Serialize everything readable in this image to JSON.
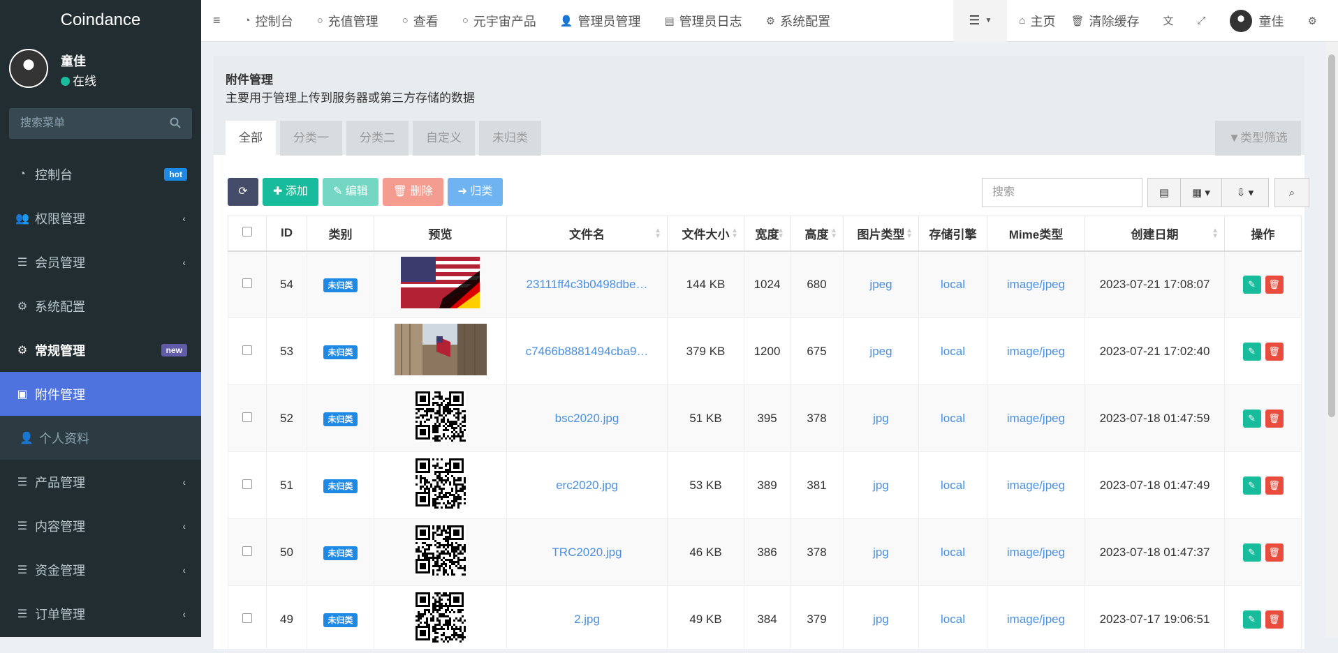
{
  "app": {
    "logo": "Coindance"
  },
  "user": {
    "name": "童佳",
    "status": "在线"
  },
  "sidebar": {
    "search_placeholder": "搜索菜单",
    "items": [
      {
        "label": "控制台",
        "tag": "hot",
        "tag_color": "#1e88e5"
      },
      {
        "label": "权限管理"
      },
      {
        "label": "会员管理"
      },
      {
        "label": "系统配置"
      },
      {
        "label": "常规管理",
        "tag": "new",
        "tag_color": "#605ca8"
      },
      {
        "label": "附件管理"
      },
      {
        "label": "个人资料"
      },
      {
        "label": "产品管理"
      },
      {
        "label": "内容管理"
      },
      {
        "label": "资金管理"
      },
      {
        "label": "订单管理"
      }
    ]
  },
  "topnav": {
    "items": [
      "控制台",
      "充值管理",
      "查看",
      "元宇宙产品",
      "管理员管理",
      "管理员日志",
      "系统配置"
    ],
    "right": {
      "home": "主页",
      "clear_cache": "清除缓存",
      "user": "童佳"
    }
  },
  "panel": {
    "title": "附件管理",
    "subtitle": "主要用于管理上传到服务器或第三方存储的数据",
    "tabs": [
      "全部",
      "分类一",
      "分类二",
      "自定义",
      "未归类"
    ],
    "filter": "类型筛选"
  },
  "toolbar": {
    "add": "添加",
    "edit": "编辑",
    "delete": "删除",
    "classify": "归类",
    "search_placeholder": "搜索"
  },
  "table": {
    "headers": [
      "ID",
      "类别",
      "预览",
      "文件名",
      "文件大小",
      "宽度",
      "高度",
      "图片类型",
      "存储引擎",
      "Mime类型",
      "创建日期",
      "操作"
    ],
    "rows": [
      {
        "id": "54",
        "cat": "未归类",
        "preview": "flag",
        "name": "23111ff4c3b0498dbe…",
        "size": "144 KB",
        "w": "1024",
        "h": "680",
        "type": "jpeg",
        "engine": "local",
        "mime": "image/jpeg",
        "date": "2023-07-21 17:08:07"
      },
      {
        "id": "53",
        "cat": "未归类",
        "preview": "building",
        "name": "c7466b8881494cba9…",
        "size": "379 KB",
        "w": "1200",
        "h": "675",
        "type": "jpeg",
        "engine": "local",
        "mime": "image/jpeg",
        "date": "2023-07-21 17:02:40"
      },
      {
        "id": "52",
        "cat": "未归类",
        "preview": "qr",
        "name": "bsc2020.jpg",
        "size": "51 KB",
        "w": "395",
        "h": "378",
        "type": "jpg",
        "engine": "local",
        "mime": "image/jpeg",
        "date": "2023-07-18 01:47:59"
      },
      {
        "id": "51",
        "cat": "未归类",
        "preview": "qr",
        "name": "erc2020.jpg",
        "size": "53 KB",
        "w": "389",
        "h": "381",
        "type": "jpg",
        "engine": "local",
        "mime": "image/jpeg",
        "date": "2023-07-18 01:47:49"
      },
      {
        "id": "50",
        "cat": "未归类",
        "preview": "qr",
        "name": "TRC2020.jpg",
        "size": "46 KB",
        "w": "386",
        "h": "378",
        "type": "jpg",
        "engine": "local",
        "mime": "image/jpeg",
        "date": "2023-07-18 01:47:37"
      },
      {
        "id": "49",
        "cat": "未归类",
        "preview": "qr",
        "name": "2.jpg",
        "size": "49 KB",
        "w": "384",
        "h": "379",
        "type": "jpg",
        "engine": "local",
        "mime": "image/jpeg",
        "date": "2023-07-17 19:06:51"
      }
    ]
  }
}
